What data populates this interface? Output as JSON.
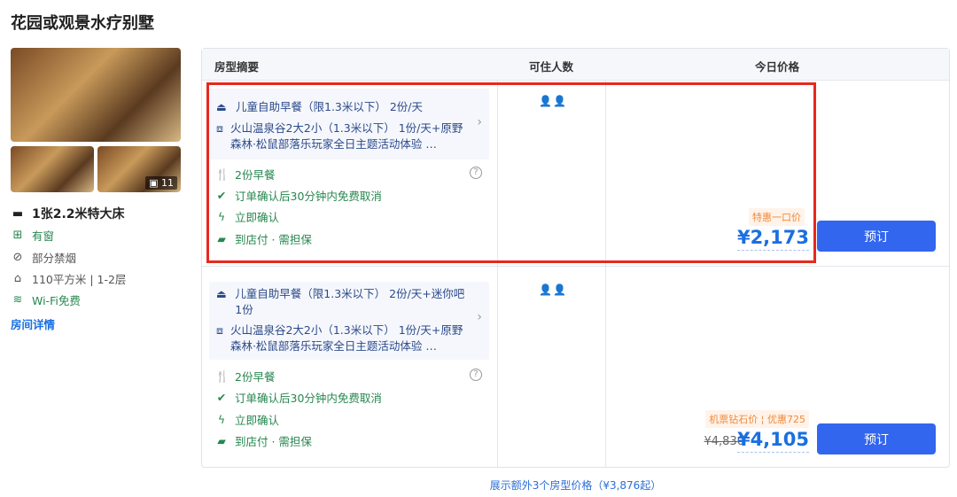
{
  "title": "花园或观景水疗别墅",
  "gallery": {
    "photo_count": "11"
  },
  "room": {
    "bed": "1张2.2米特大床",
    "features": [
      {
        "icon": "window-icon",
        "text": "有窗",
        "color": "green"
      },
      {
        "icon": "no-smoking-icon",
        "text": "部分禁烟",
        "color": "gray"
      },
      {
        "icon": "area-icon",
        "text": "110平方米 | 1-2层",
        "color": "gray"
      },
      {
        "icon": "wifi-icon",
        "text": "Wi-Fi免费",
        "color": "green"
      }
    ],
    "details_link": "房间详情"
  },
  "table": {
    "headers": [
      "房型摘要",
      "可住人数",
      "今日价格"
    ],
    "rows": [
      {
        "package": [
          "儿童自助早餐（限1.3米以下） 2份/天",
          "火山温泉谷2大2小（1.3米以下） 1份/天+原野森林·松鼠部落乐玩家全日主题活动体验 …"
        ],
        "perks": [
          "2份早餐",
          "订单确认后30分钟内免费取消",
          "立即确认",
          "到店付 · 需担保"
        ],
        "guests": "2",
        "tag": "特惠一口价",
        "price": "¥2,173",
        "book": "预订",
        "highlighted": true
      },
      {
        "package": [
          "儿童自助早餐（限1.3米以下） 2份/天+迷你吧 1份",
          "火山温泉谷2大2小（1.3米以下） 1份/天+原野森林·松鼠部落乐玩家全日主题活动体验 …"
        ],
        "perks": [
          "2份早餐",
          "订单确认后30分钟内免费取消",
          "立即确认",
          "到店付 · 需担保"
        ],
        "guests": "2",
        "tag": "机票钻石价",
        "discount": "优惠725",
        "original_price": "¥4,830",
        "price": "¥4,105",
        "book": "预订"
      }
    ]
  },
  "footer_link": "展示额外3个房型价格（¥3,876起）",
  "colors": {
    "accent": "#3366ee",
    "price": "#1a6fe0",
    "perk": "#26874f",
    "highlight": "#e8281e"
  }
}
